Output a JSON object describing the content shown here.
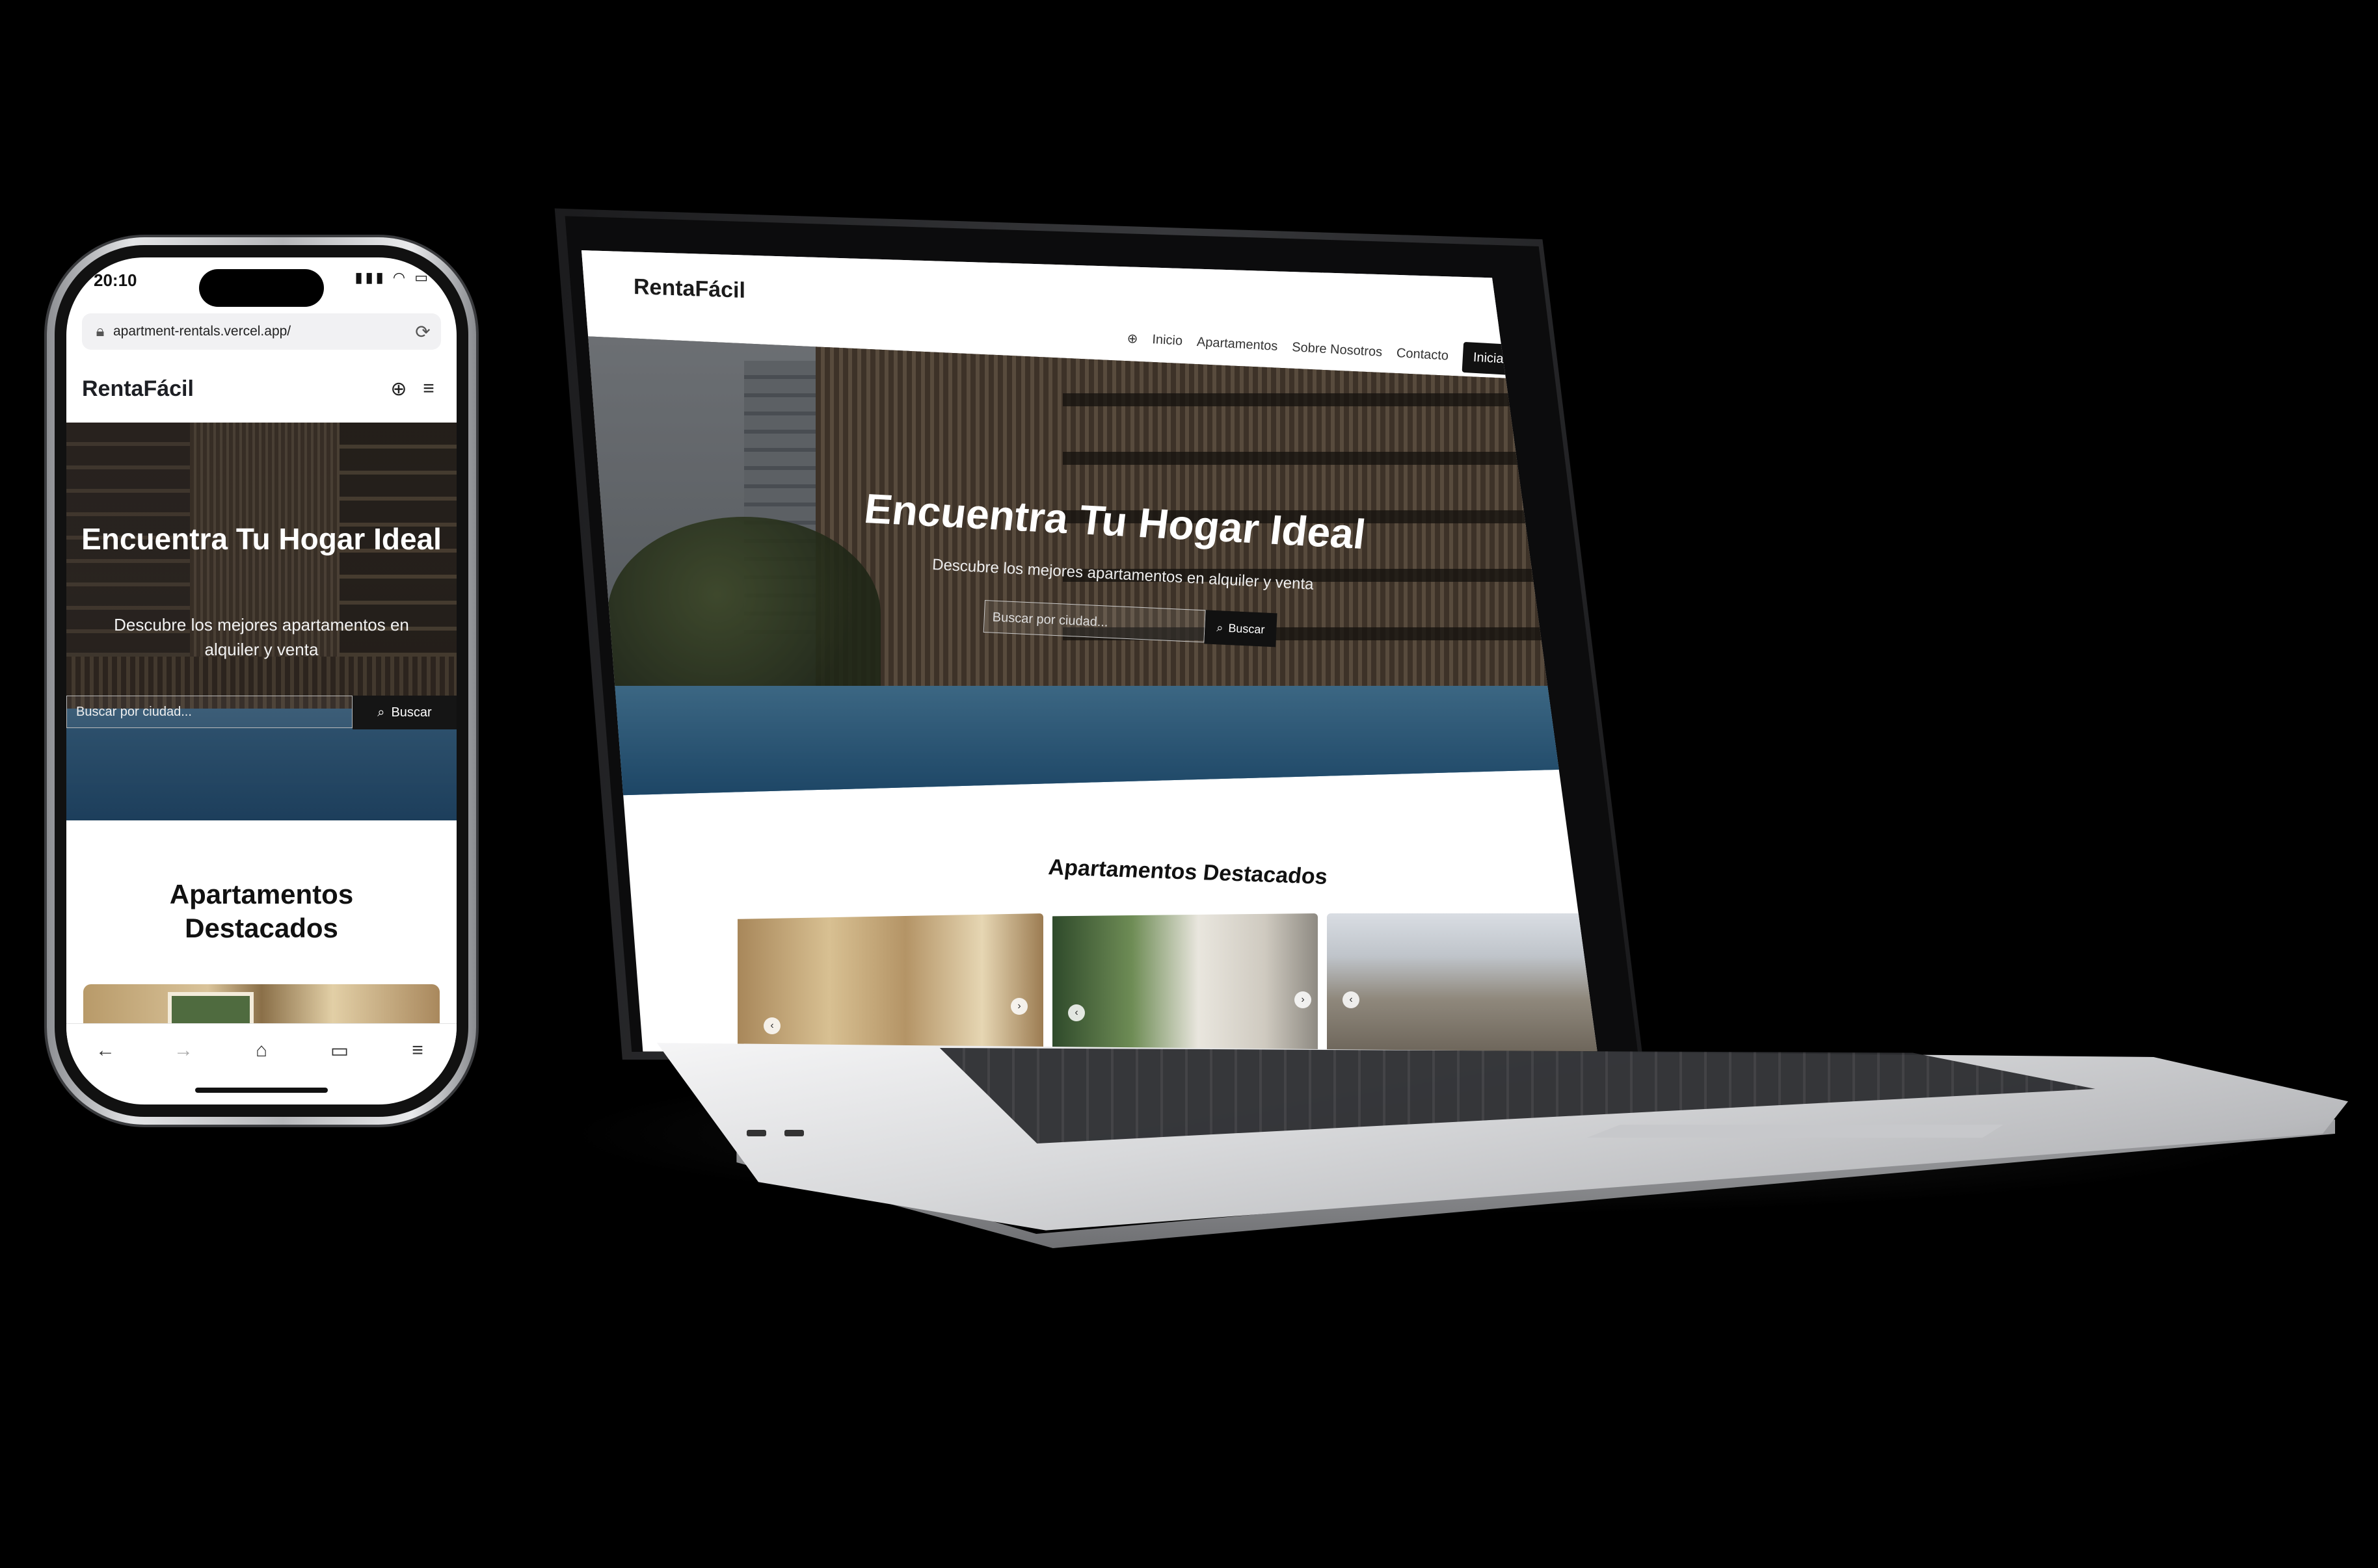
{
  "phone": {
    "status_time": "20:10",
    "status_icons": "▮▮▮ ◠ ▭",
    "url": "apartment-rentals.vercel.app/",
    "icons": {
      "lock": "lock-icon",
      "reload": "reload-icon",
      "globe": "globe-icon",
      "menu": "hamburger-menu-icon"
    },
    "brand": "RentaFácil",
    "hero": {
      "title": "Encuentra Tu Hogar Ideal",
      "subtitle": "Descubre los mejores apartamentos en alquiler y venta",
      "search_placeholder": "Buscar por ciudad...",
      "search_button": "Buscar"
    },
    "featured_title": "Apartamentos Destacados",
    "toolbar": {
      "back": "←",
      "forward": "→",
      "home": "⌂",
      "tabs": "▭",
      "menu": "≡"
    }
  },
  "laptop": {
    "brand": "RentaFácil",
    "nav": {
      "links": [
        "Inicio",
        "Apartamentos",
        "Sobre Nosotros",
        "Contacto"
      ],
      "cta": "Iniciar Sesión"
    },
    "hero": {
      "title": "Encuentra Tu Hogar Ideal",
      "subtitle": "Descubre los mejores apartamentos en alquiler y venta",
      "search_placeholder": "Buscar por ciudad...",
      "search_button": "Buscar"
    },
    "featured_title": "Apartamentos Destacados"
  },
  "colors": {
    "brand_dark": "#111111",
    "page_bg": "#000000",
    "hero_overlay": "rgba(0,0,0,0.35)"
  }
}
